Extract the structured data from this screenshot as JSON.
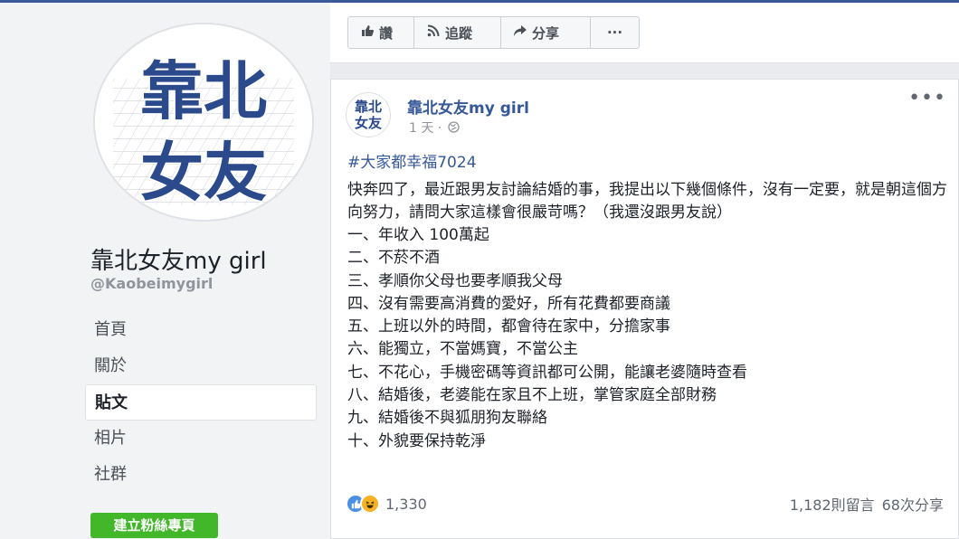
{
  "page": {
    "name": "靠北女友my girl",
    "handle": "@Kaobeimygirl",
    "avatar_text": [
      "靠北",
      "女友"
    ],
    "nav": [
      "首頁",
      "關於",
      "貼文",
      "相片",
      "社群"
    ],
    "active_nav": "貼文",
    "create_page_button": "建立粉絲專頁"
  },
  "actions": {
    "like": "讚",
    "follow": "追蹤",
    "share": "分享",
    "more": "···"
  },
  "post": {
    "avatar_text": [
      "靠北",
      "女友"
    ],
    "author": "靠北女友my girl",
    "time": "1 天 ·",
    "hashtag": "#大家都幸福7024",
    "intro": "快奔四了，最近跟男友討論結婚的事，我提出以下幾個條件，沒有一定要，就是朝這個方向努力，請問大家這樣會很嚴苛嗎？（我還沒跟男友說）",
    "items": [
      "一、年收入 100萬起",
      "二、不菸不酒",
      "三、孝順你父母也要孝順我父母",
      "四、沒有需要高消費的愛好，所有花費都要商議",
      "五、上班以外的時間，都會待在家中，分擔家事",
      "六、能獨立，不當媽寶，不當公主",
      "七、不花心，手機密碼等資訊都可公開，能讓老婆隨時查看",
      "八、結婚後，老婆能在家且不上班，掌管家庭全部財務",
      "九、結婚後不與狐朋狗友聯絡",
      "十、外貌要保持乾淨"
    ],
    "reactions_count": "1,330",
    "comments": "1,182則留言",
    "shares": "68次分享"
  },
  "colors": {
    "link": "#365899",
    "green_button": "#42b72a",
    "avatar_text": "#2b4a8b"
  },
  "icons": [
    "thumbs-up-icon",
    "rss-icon",
    "share-arrow-icon",
    "more-icon",
    "globe-icon",
    "like-reaction-icon",
    "haha-reaction-icon"
  ]
}
